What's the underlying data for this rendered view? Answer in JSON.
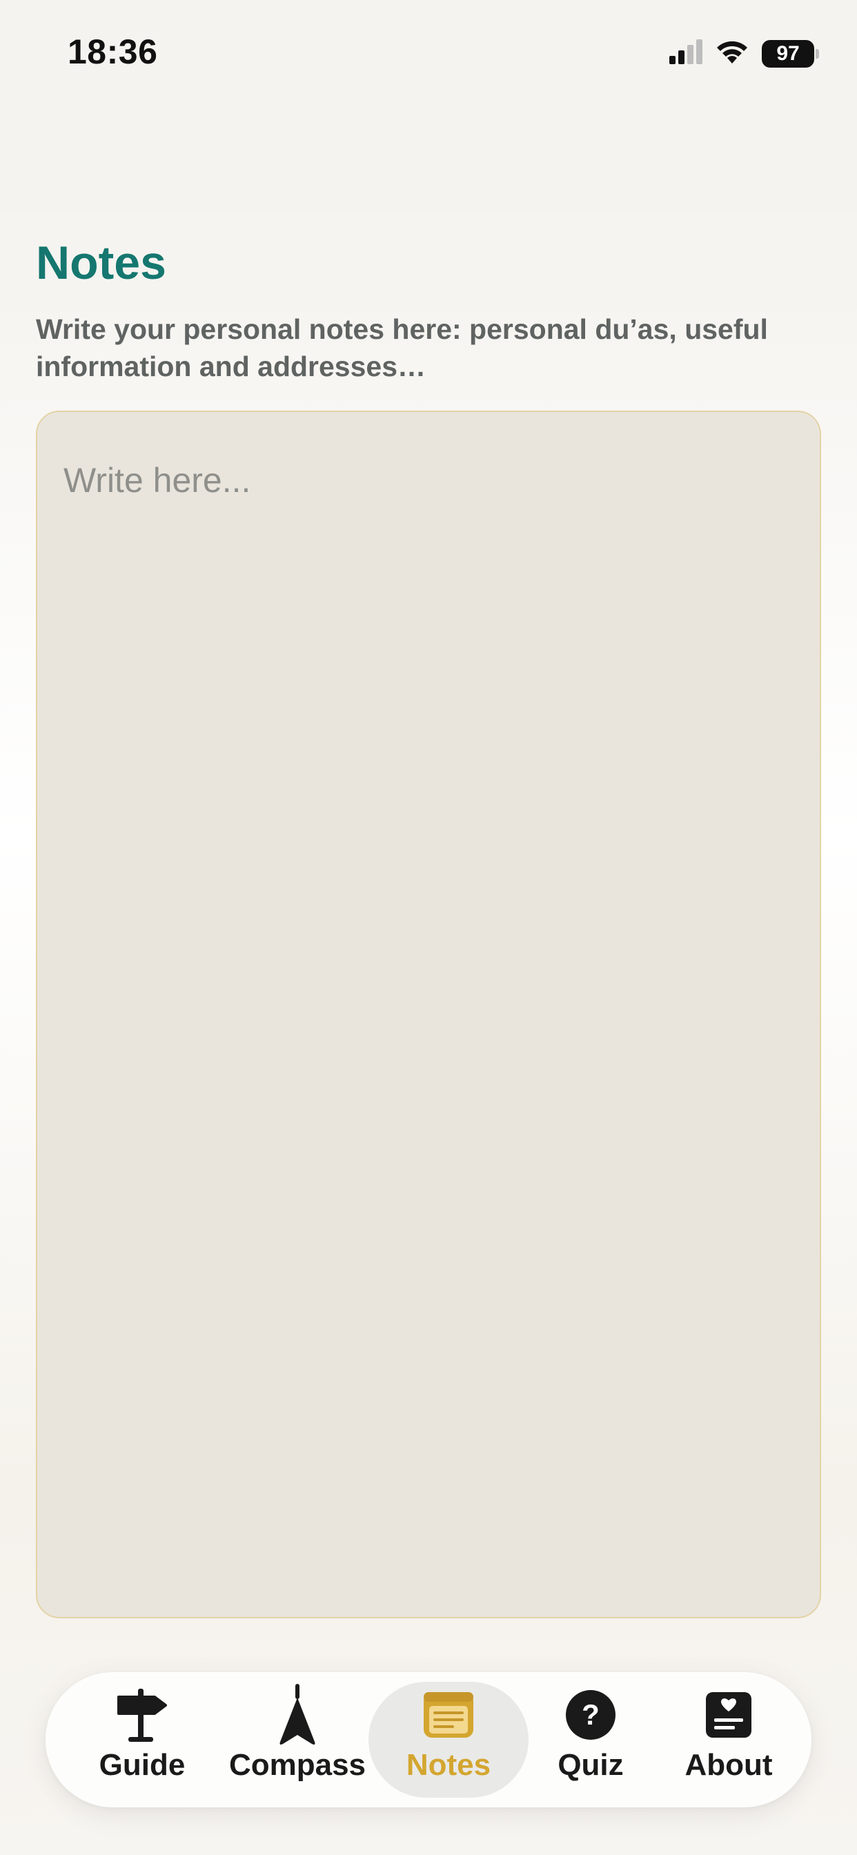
{
  "status_bar": {
    "time": "18:36",
    "battery_level": "97",
    "icons": [
      "cellular-signal-icon",
      "wifi-icon",
      "battery-icon"
    ]
  },
  "page": {
    "title": "Notes",
    "subtitle": "Write your personal notes here: personal du’as, useful information and addresses…",
    "notes_placeholder": "Write here...",
    "notes_value": ""
  },
  "tab_bar": {
    "active": "Notes",
    "tabs": [
      {
        "label": "Guide",
        "icon": "signpost-icon"
      },
      {
        "label": "Compass",
        "icon": "compass-arrow-icon"
      },
      {
        "label": "Notes",
        "icon": "notes-icon"
      },
      {
        "label": "Quiz",
        "icon": "question-icon"
      },
      {
        "label": "About",
        "icon": "about-heart-icon"
      }
    ]
  },
  "colors": {
    "title": "#15776f",
    "accent_active": "#d4a630",
    "notes_background": "#e9e5dc",
    "notes_border": "#e3d3a6"
  }
}
